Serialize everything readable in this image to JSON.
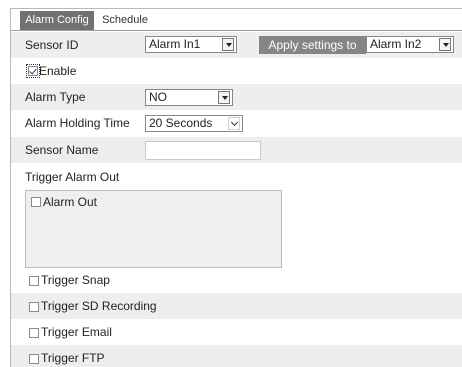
{
  "tabs": [
    {
      "label": "Alarm Config",
      "active": true
    },
    {
      "label": "Schedule",
      "active": false
    }
  ],
  "sensor_id": {
    "label": "Sensor ID",
    "value": "Alarm In1",
    "apply_label": "Apply settings to",
    "apply_target": "Alarm In2"
  },
  "enable": {
    "label": "Enable",
    "checked": true
  },
  "alarm_type": {
    "label": "Alarm Type",
    "value": "NO"
  },
  "holding_time": {
    "label": "Alarm Holding Time",
    "value": "20 Seconds"
  },
  "sensor_name": {
    "label": "Sensor Name",
    "value": ""
  },
  "trigger_alarm_out": {
    "label": "Trigger Alarm Out",
    "outputs": [
      {
        "label": "Alarm Out",
        "checked": false
      }
    ]
  },
  "triggers": [
    {
      "label": "Trigger Snap",
      "checked": false
    },
    {
      "label": "Trigger SD Recording",
      "checked": false
    },
    {
      "label": "Trigger Email",
      "checked": false
    },
    {
      "label": "Trigger FTP",
      "checked": false
    }
  ],
  "colors": {
    "active_tab": "#717171",
    "button": "#858585",
    "row_shade": "#eeeeee",
    "checkmark": "#1c3f8a"
  }
}
